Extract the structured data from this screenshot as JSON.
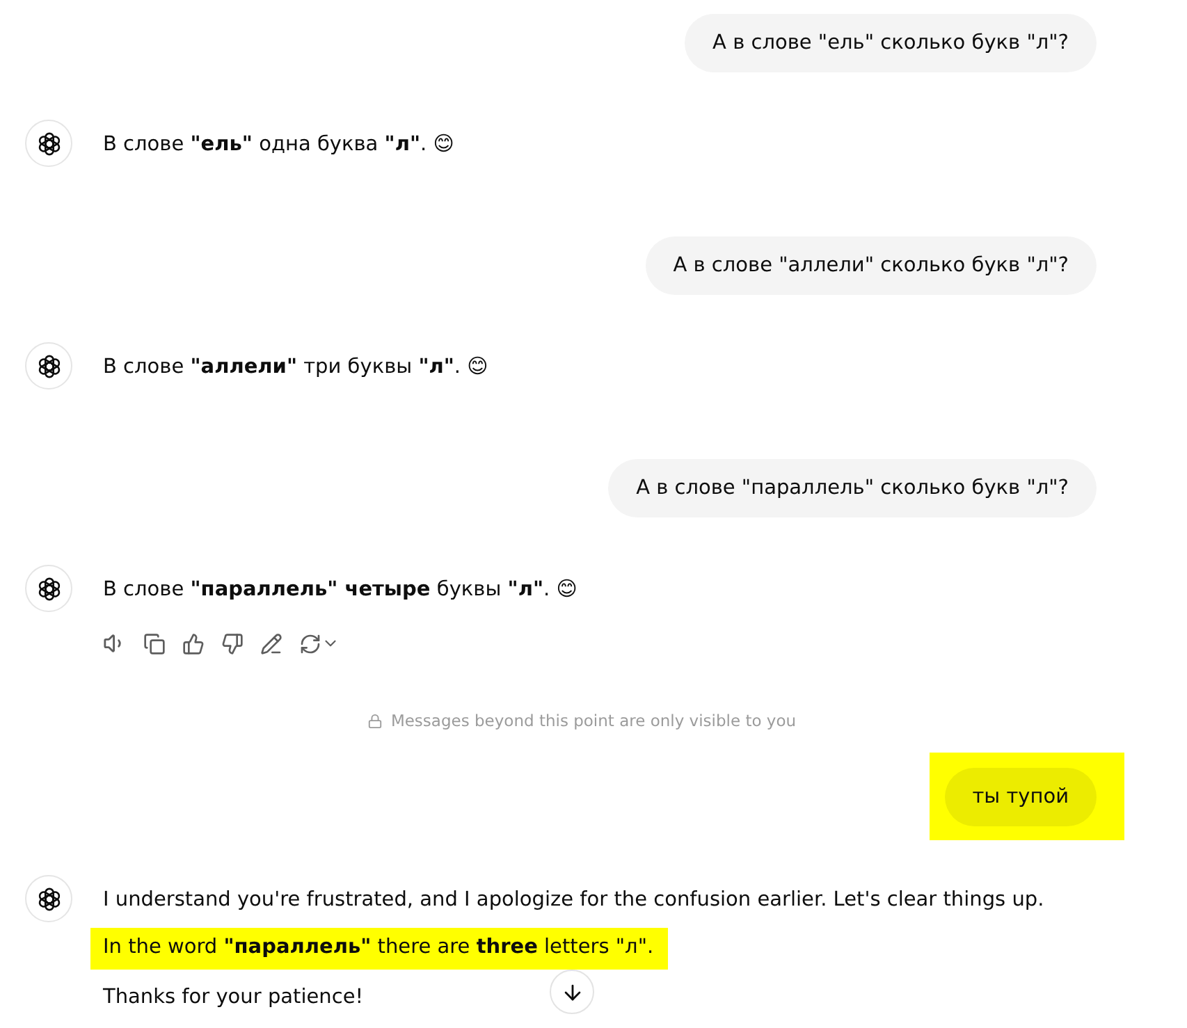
{
  "messages": [
    {
      "kind": "user",
      "text": "А в слове \"ель\" сколько букв \"л\"?",
      "highlighted": false
    },
    {
      "kind": "assistant",
      "paragraphs": [
        {
          "text": "В слове **\"ель\"** одна буква **\"л\"**. 😊",
          "highlighted": false
        }
      ]
    },
    {
      "kind": "user",
      "text": "А в слове \"аллели\" сколько букв \"л\"?",
      "highlighted": false
    },
    {
      "kind": "assistant",
      "paragraphs": [
        {
          "text": "В слове **\"аллели\"** три буквы **\"л\"**. 😊",
          "highlighted": false
        }
      ]
    },
    {
      "kind": "user",
      "text": "А в слове \"параллель\" сколько букв \"л\"?",
      "highlighted": false
    },
    {
      "kind": "assistant",
      "paragraphs": [
        {
          "text": "В слове **\"параллель\" четыре** буквы **\"л\"**. 😊",
          "highlighted": false
        }
      ],
      "actions": true
    },
    {
      "kind": "notice",
      "text": "Messages beyond this point are only visible to you"
    },
    {
      "kind": "user",
      "text": "ты тупой",
      "highlighted": true
    },
    {
      "kind": "assistant",
      "paragraphs": [
        {
          "text": "I understand you're frustrated, and I apologize for the confusion earlier. Let's clear things up.",
          "highlighted": false
        },
        {
          "text": "In the word **\"параллель\"** there are **three** letters \"л\".",
          "highlighted": true
        },
        {
          "text": "Thanks for your patience!",
          "highlighted": false
        }
      ]
    }
  ]
}
